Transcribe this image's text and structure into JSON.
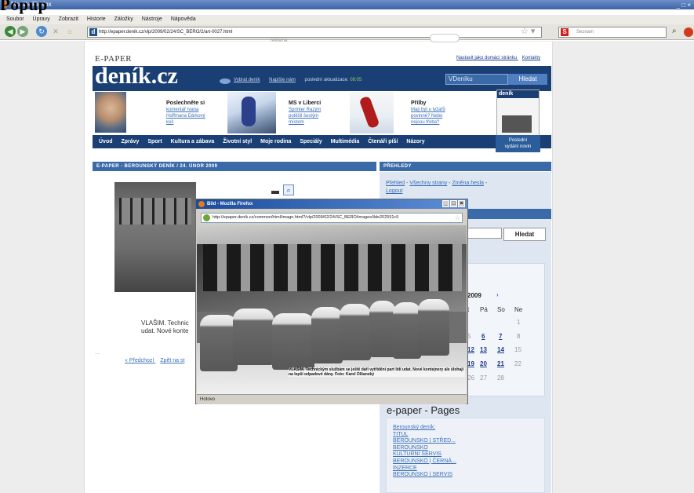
{
  "browser": {
    "window_title": "Mozilla Firefox",
    "menu": [
      "Soubor",
      "Úpravy",
      "Zobrazit",
      "Historie",
      "Záložky",
      "Nástroje",
      "Nápověda"
    ],
    "url": "http://epaper.denik.cz/vlp/2009/02/24/SC_BERO/2/art-0027.html",
    "search_placeholder": "Seznam",
    "overlay_heading": "Popup"
  },
  "page": {
    "reklama": "reklama",
    "epaper_label": "E-PAPER",
    "toplinks": [
      "Nastavit jako domácí stránku",
      "Kontakty"
    ],
    "logo": "deník.cz",
    "brand_links": {
      "vybrat": "Vybrat deník",
      "napiste": "Napište nám",
      "aktualizace_label": "poslední aktualizace:",
      "aktualizace_time": "08:05"
    },
    "search_value": "VDeníku",
    "search_button": "Hledat",
    "teasers": [
      {
        "title": "Poslechněte si",
        "lines": [
          "komentář Ivana",
          "Hoffmana Dárkový",
          "koš"
        ]
      },
      {
        "title": "MS v Liberci",
        "lines": [
          "Sprinter Razým",
          "potěšil šestým",
          "místem"
        ]
      },
      {
        "title": "Přilby",
        "lines": [
          "Mají být u lyžařů",
          "povinné? Nebo",
          "nejsou třeba?"
        ]
      }
    ],
    "newspaper_head": "deník",
    "posledni": [
      "Poslední",
      "vydání novin"
    ],
    "nav": [
      "Úvod",
      "Zprávy",
      "Sport",
      "Kultura a zábava",
      "Životní styl",
      "Moje rodina",
      "Speciály",
      "Multimédia",
      "Čtenáři píší",
      "Názory"
    ]
  },
  "content": {
    "section_title": "E-PAPER - BEROUNSKÝ DENÍK / 24. ÚNOR 2009",
    "caption": "VLAŠIM. Technic... udat. Nové konte...",
    "caption_line1": "VLAŠIM. Technic",
    "caption_line2": "udat. Nové konte",
    "dots": "...",
    "pager_prev": "« Předchozí",
    "pager_back": "Zpět na st"
  },
  "sidebar": {
    "prehledy_title": "PŘEHLEDY",
    "links": [
      "Přehled",
      "Všechny strany",
      "Změna hesla",
      "Logout"
    ],
    "search_button": "Hledat",
    "calendar": {
      "month_label": "2009",
      "next": "›",
      "dow": [
        "t",
        "Pá",
        "So",
        "Ne"
      ],
      "rows": [
        [
          "",
          "",
          "",
          "1"
        ],
        [
          "5",
          "6",
          "7",
          "8"
        ],
        [
          "12",
          "13",
          "14",
          "15"
        ],
        [
          "19",
          "20",
          "21",
          "22"
        ],
        [
          "26",
          "27",
          "28",
          ""
        ]
      ]
    },
    "pages_title": "e-paper - Pages",
    "pages": [
      "Berounský deník:",
      "TITUL",
      "BEROUNSKO | STŘED...",
      "BEROUNSKO",
      "KULTURNÍ SERVIS",
      "BEROUNSKO | ČERNÁ...",
      "INZERCE",
      "BEROUNSKO | SERVIS"
    ]
  },
  "popup": {
    "title": "Bild - Mozilla Firefox",
    "url": "http://epaper.denik.cz/common/html/image.html?/vlp/2009/02/24/SC_BERO/images/ilde202551c9",
    "caption": "VLAŠIM. Technickým službám se ještě daří vytřídění part lidí udat. Nové kontejnery ale úlohaji na lepší odpadové dány. Foto: Karel Olšanský",
    "status": "Hotovo"
  },
  "colors": {
    "brand_navy": "#1a3f75",
    "section_blue": "#3a6aa8",
    "link_blue": "#3a6fb8"
  }
}
